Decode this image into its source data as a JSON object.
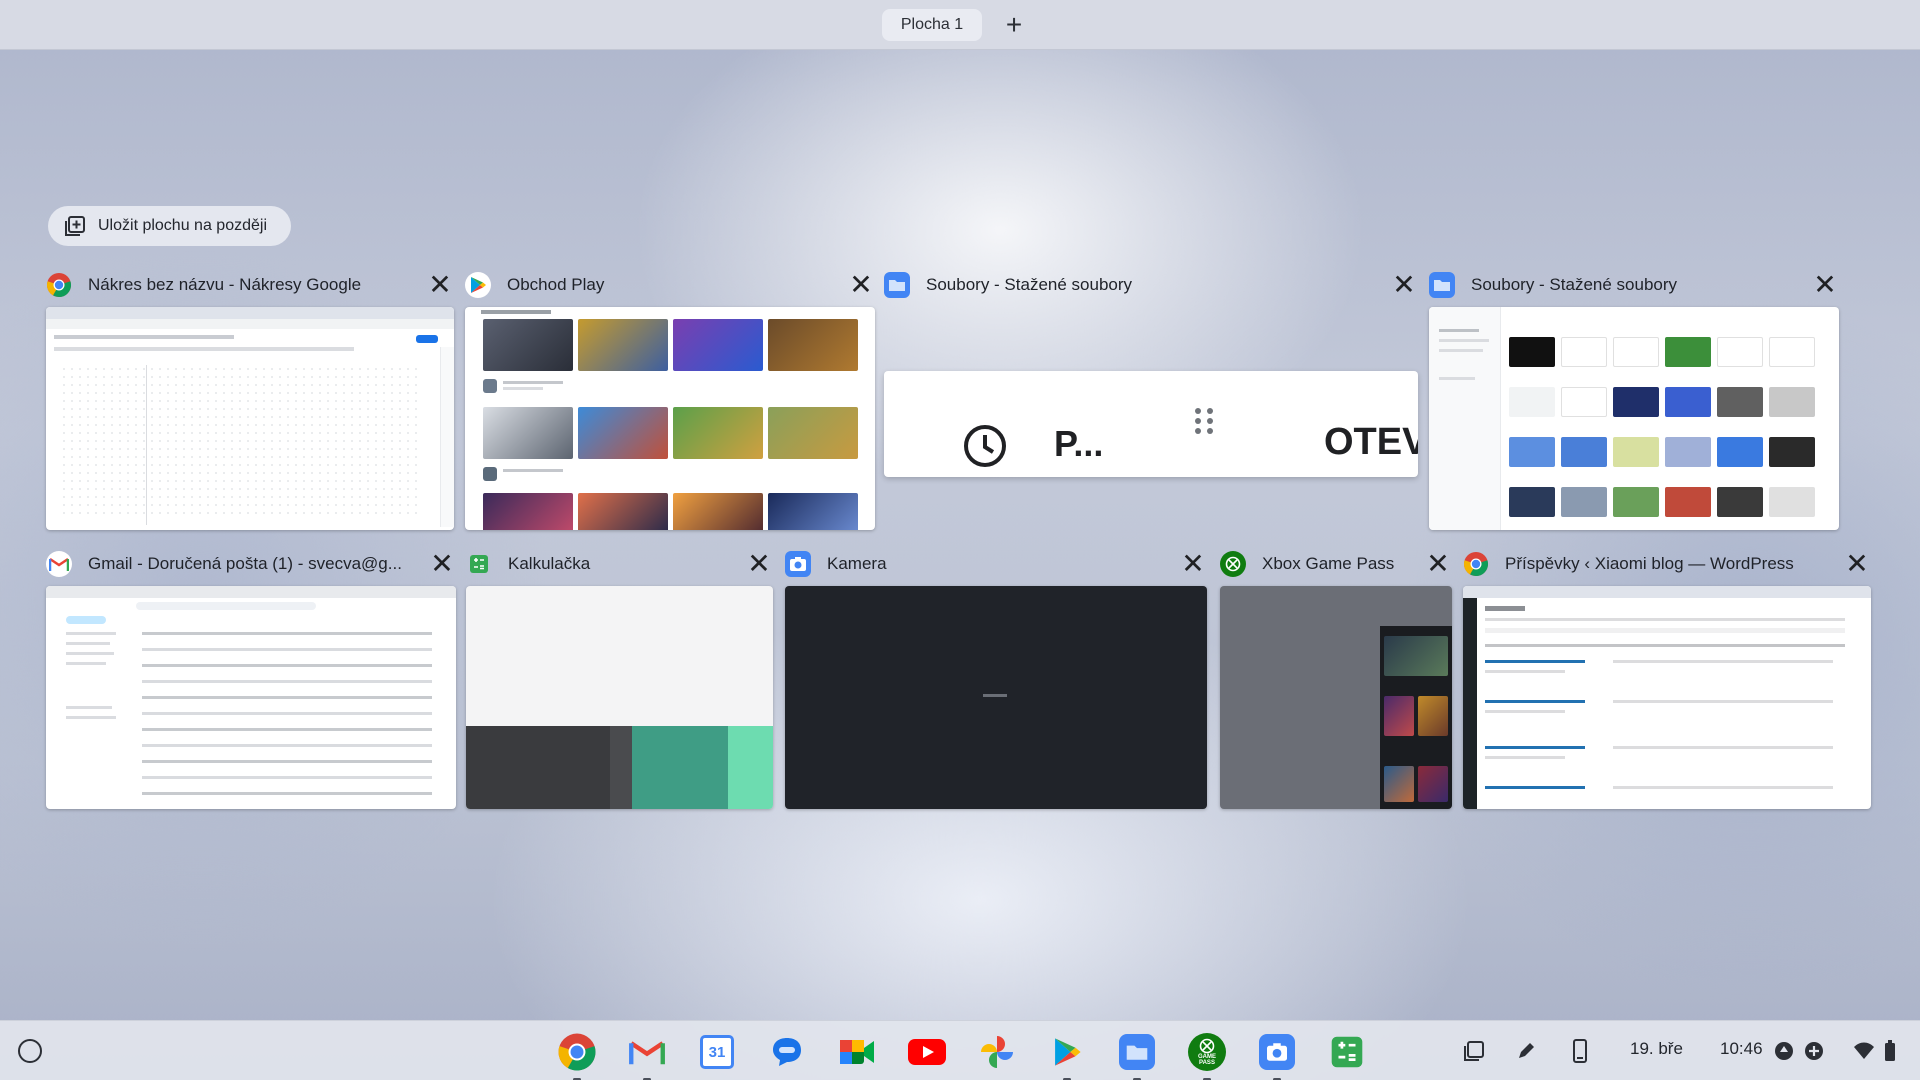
{
  "desk_bar": {
    "desk_name": "Plocha 1",
    "add_desk_symbol": "+"
  },
  "save_desk": {
    "label": "Uložit plochu na později",
    "icon": "save-desk-icon"
  },
  "windows": [
    {
      "title": "Nákres bez názvu - Nákresy Google",
      "icon": "chrome-icon"
    },
    {
      "title": "Obchod Play",
      "icon": "play-store-icon"
    },
    {
      "title": "Soubory - Stažené soubory",
      "icon": "files-icon"
    },
    {
      "title": "Soubory - Stažené soubory",
      "icon": "files-icon"
    },
    {
      "title": "Gmail - Doručená pošta (1) - svecva@g...",
      "icon": "gmail-icon"
    },
    {
      "title": "Kalkulačka",
      "icon": "calculator-icon"
    },
    {
      "title": "Kamera",
      "icon": "camera-icon"
    },
    {
      "title": "Xbox Game Pass",
      "icon": "xbox-icon"
    },
    {
      "title": "Příspěvky ‹ Xiaomi blog — WordPress",
      "icon": "chrome-icon"
    }
  ],
  "files_window_popup": {
    "item_label": "P...",
    "action_label": "OTEV"
  },
  "shelf": {
    "apps": [
      "Chrome",
      "Gmail",
      "Kalendář",
      "Zprávy",
      "Meet",
      "YouTube",
      "Fotky",
      "Obchod Play",
      "Soubory",
      "Xbox Game Pass",
      "Kamera",
      "Kalkulačka"
    ],
    "calendar_day": "31",
    "gamepass_label": "GAME PASS",
    "date": "19. bře",
    "time": "10:46"
  }
}
